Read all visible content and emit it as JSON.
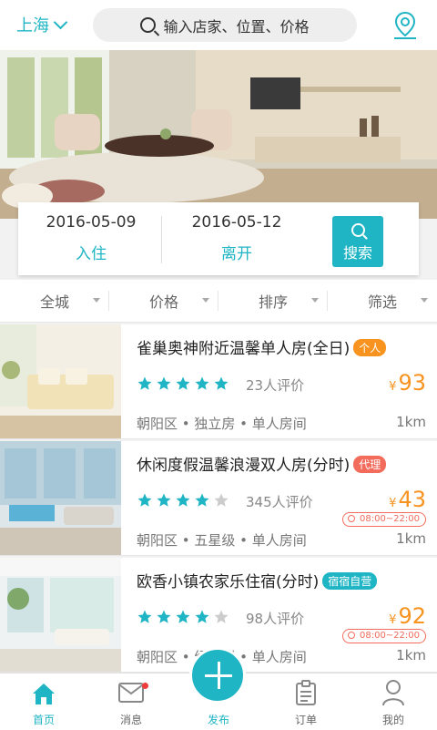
{
  "header": {
    "city": "上海",
    "search_placeholder": "输入店家、位置、价格"
  },
  "date_picker": {
    "checkin_date": "2016-05-09",
    "checkin_label": "入住",
    "checkout_date": "2016-05-12",
    "checkout_label": "离开",
    "search_label": "搜索"
  },
  "filters": [
    "全城",
    "价格",
    "排序",
    "筛选"
  ],
  "listings": [
    {
      "name": "雀巢奥神附近温馨单人房(全日)",
      "badge": "个人",
      "badge_color": "#f7931e",
      "rating": 5,
      "reviews": "23人评价",
      "currency": "¥",
      "price": "93",
      "time": "",
      "meta": "朝阳区 • 独立房 • 单人房间",
      "distance": "1km"
    },
    {
      "name": "休闲度假温馨浪漫双人房(分时)",
      "badge": "代理",
      "badge_color": "#f26b5b",
      "rating": 4,
      "reviews": "345人评价",
      "currency": "¥",
      "price": "43",
      "time": "08:00~22:00",
      "meta": "朝阳区 • 五星级 • 单人房间",
      "distance": "1km"
    },
    {
      "name": "欧香小镇农家乐住宿(分时)",
      "badge": "宿宿自营",
      "badge_color": "#1fb5c4",
      "rating": 4,
      "reviews": "98人评价",
      "currency": "¥",
      "price": "92",
      "time": "08:00~22:00",
      "meta": "朝阳区 • 经济型 • 单人房间",
      "distance": "1km"
    }
  ],
  "tabs": [
    {
      "label": "首页",
      "icon": "home-icon",
      "active": true
    },
    {
      "label": "消息",
      "icon": "mail-icon",
      "active": false
    },
    {
      "label": "发布",
      "icon": "plus-icon",
      "active": false
    },
    {
      "label": "订单",
      "icon": "clipboard-icon",
      "active": false
    },
    {
      "label": "我的",
      "icon": "user-icon",
      "active": false
    }
  ],
  "colors": {
    "accent": "#1fb5c4",
    "price": "#f7931e",
    "star_on": "#1fb5c4",
    "star_off": "#cccccc"
  }
}
